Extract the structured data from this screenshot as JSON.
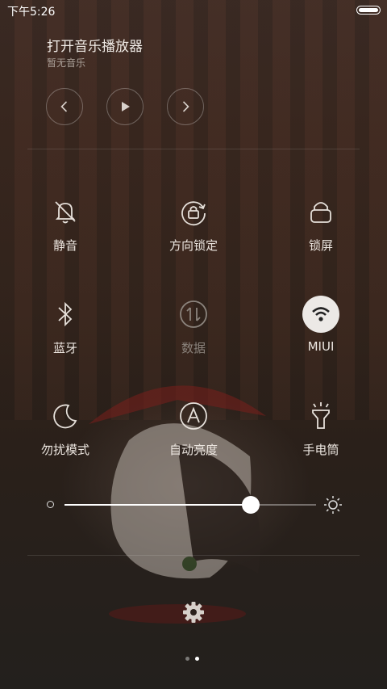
{
  "status_bar": {
    "time": "下午5:26"
  },
  "music": {
    "title": "打开音乐播放器",
    "subtitle": "暂无音乐",
    "controls": [
      "previous-icon",
      "play-icon",
      "next-icon"
    ]
  },
  "toggles": [
    {
      "label": "静音",
      "icon": "bell-off-icon",
      "active": false
    },
    {
      "label": "方向锁定",
      "icon": "rotation-lock-icon",
      "active": false
    },
    {
      "label": "锁屏",
      "icon": "lock-icon",
      "active": false
    },
    {
      "label": "蓝牙",
      "icon": "bluetooth-icon",
      "active": false
    },
    {
      "label": "数据",
      "icon": "mobile-data-icon",
      "active": false,
      "disabled": true
    },
    {
      "label": "MIUI",
      "icon": "wifi-icon",
      "active": true
    },
    {
      "label": "勿扰模式",
      "icon": "moon-icon",
      "active": false
    },
    {
      "label": "自动亮度",
      "icon": "auto-brightness-icon",
      "active": false
    },
    {
      "label": "手电筒",
      "icon": "flashlight-icon",
      "active": false
    }
  ],
  "brightness": {
    "value": 0.74
  },
  "pager": {
    "count": 2,
    "current": 1
  },
  "colors": {
    "active_tile_bg": "#ece9e6",
    "text": "#ece6e0",
    "dim_text": "#8b837c"
  }
}
